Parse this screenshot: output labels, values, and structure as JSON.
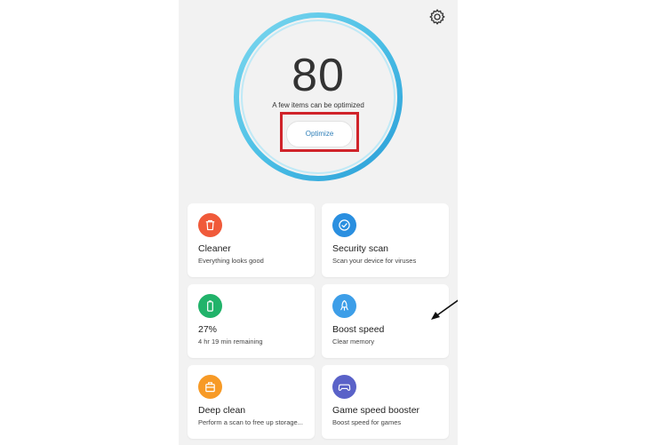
{
  "header": {
    "settings_icon": "gear-icon"
  },
  "score": {
    "value": "80",
    "subtitle": "A few items can be optimized",
    "button_label": "Optimize",
    "ring_color": "#42b8e0"
  },
  "cards": [
    {
      "icon": "trash-icon",
      "color": "#f05a3a",
      "title": "Cleaner",
      "subtitle": "Everything looks good"
    },
    {
      "icon": "shield-check-icon",
      "color": "#2a8fe0",
      "title": "Security scan",
      "subtitle": "Scan your device for viruses"
    },
    {
      "icon": "battery-icon",
      "color": "#21b36a",
      "title": "27%",
      "subtitle": "4 hr 19 min  remaining"
    },
    {
      "icon": "rocket-icon",
      "color": "#3d9ee8",
      "title": "Boost speed",
      "subtitle": "Clear memory"
    },
    {
      "icon": "suitcase-icon",
      "color": "#f79a26",
      "title": "Deep clean",
      "subtitle": "Perform a scan to free up storage..."
    },
    {
      "icon": "gamepad-icon",
      "color": "#5a62c8",
      "title": "Game speed booster",
      "subtitle": "Boost speed for games"
    }
  ],
  "annotations": {
    "highlight_color": "#d0232a",
    "arrow": "arrow-pointing-to-battery"
  }
}
